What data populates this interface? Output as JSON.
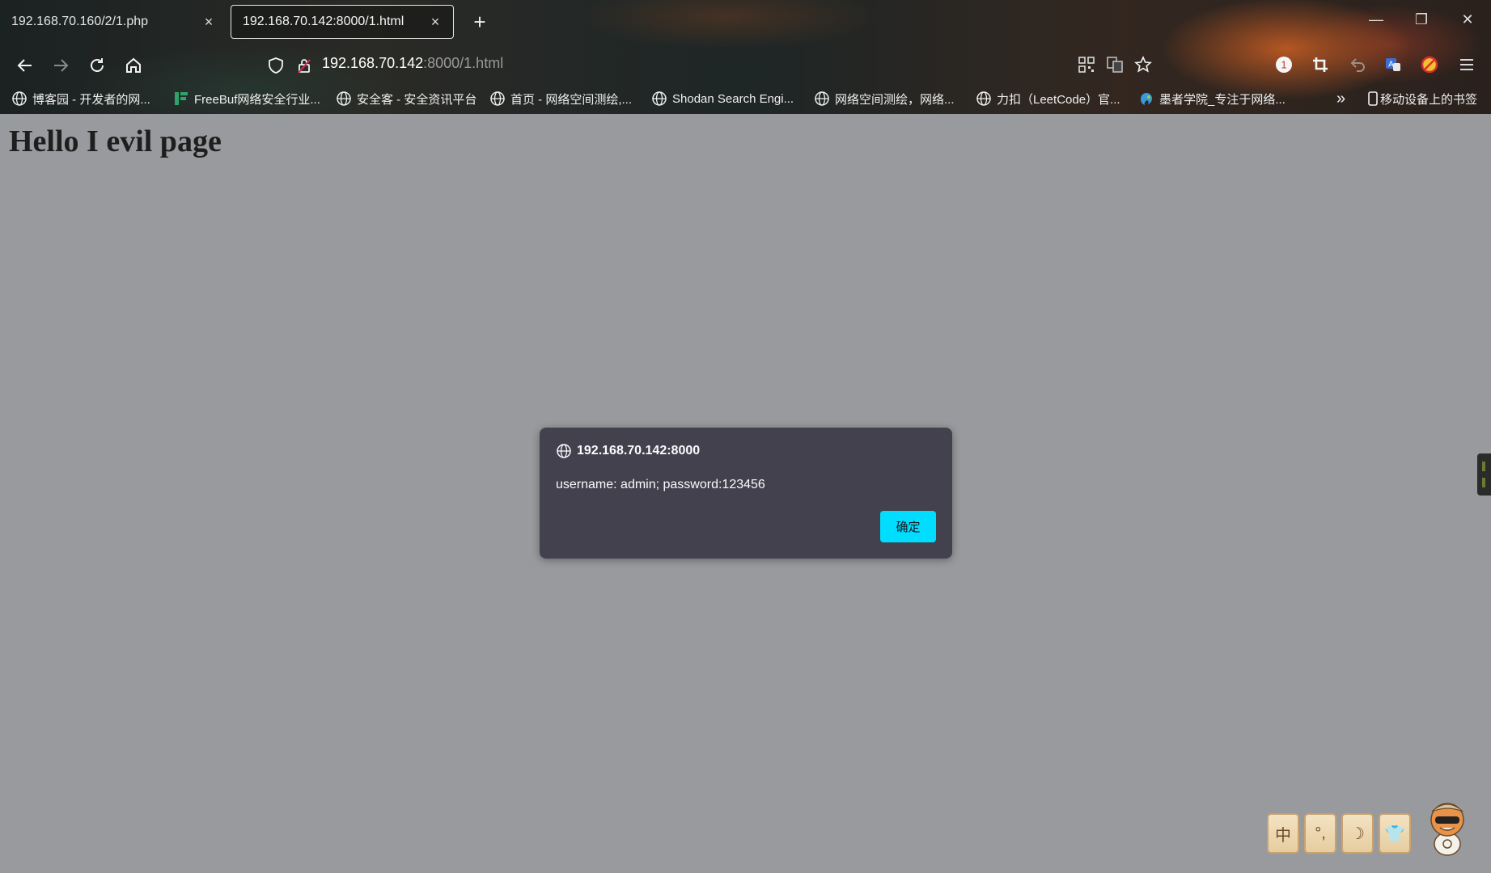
{
  "browser": {
    "tabs": [
      {
        "title": "192.168.70.160/2/1.php",
        "active": false
      },
      {
        "title": "192.168.70.142:8000/1.html",
        "active": true
      }
    ],
    "close_glyph": "×",
    "new_tab_glyph": "+",
    "window_controls": {
      "minimize": "—",
      "restore": "❐",
      "close": "✕"
    },
    "url": {
      "host": "192.168.70.142",
      "rest": ":8000/1.html"
    },
    "toolbar_icons": [
      "qr-code-icon",
      "translate-icon",
      "star-bookmark-icon",
      "badge-extension-icon",
      "crop-icon",
      "undo-icon",
      "translate-ext-icon",
      "blocker-ext-icon",
      "menu-icon"
    ],
    "toolbar_badge": "1",
    "bookmarks": [
      {
        "label": "博客园 - 开发者的网...",
        "icon": "globe-icon"
      },
      {
        "label": "FreeBuf网络安全行业...",
        "icon": "freebuf-icon"
      },
      {
        "label": "安全客 - 安全资讯平台",
        "icon": "globe-icon"
      },
      {
        "label": "首页 - 网络空间测绘,...",
        "icon": "globe-icon"
      },
      {
        "label": "Shodan Search Engi...",
        "icon": "globe-icon"
      },
      {
        "label": "网络空间测绘，网络...",
        "icon": "globe-icon"
      },
      {
        "label": "力扣（LeetCode）官...",
        "icon": "globe-icon"
      },
      {
        "label": "墨者学院_专注于网络...",
        "icon": "mozhe-icon"
      }
    ],
    "bookmarks_overflow": "»",
    "mobile_bookmarks": "移动设备上的书签"
  },
  "page": {
    "heading": "Hello I evil page"
  },
  "dialog": {
    "origin": "192.168.70.142:8000",
    "message": "username: admin; password:123456",
    "ok_label": "确定"
  },
  "widget": {
    "tiles": [
      "中",
      "°,",
      "☽",
      "👕"
    ]
  },
  "colors": {
    "page_background": "#999a9d",
    "dialog_background": "#42414d",
    "dialog_button": "#00ddff"
  }
}
